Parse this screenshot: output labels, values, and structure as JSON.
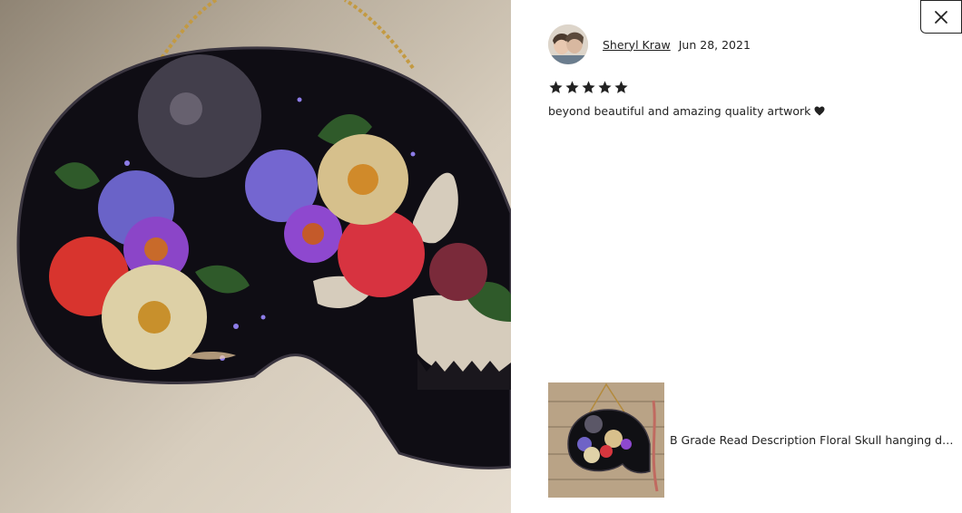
{
  "review": {
    "reviewer_name": "Sheryl Kraw",
    "date": "Jun 28, 2021",
    "rating": 5,
    "rating_max": 5,
    "text": "beyond beautiful and amazing quality artwork",
    "text_icon": "heart-icon"
  },
  "product": {
    "title": "B Grade Read Description Floral Skull hanging dec..."
  },
  "icons": {
    "close": "close-icon",
    "star": "star-icon",
    "heart": "heart-icon"
  },
  "colors": {
    "text": "#222222",
    "star": "#222222",
    "background": "#ffffff"
  }
}
